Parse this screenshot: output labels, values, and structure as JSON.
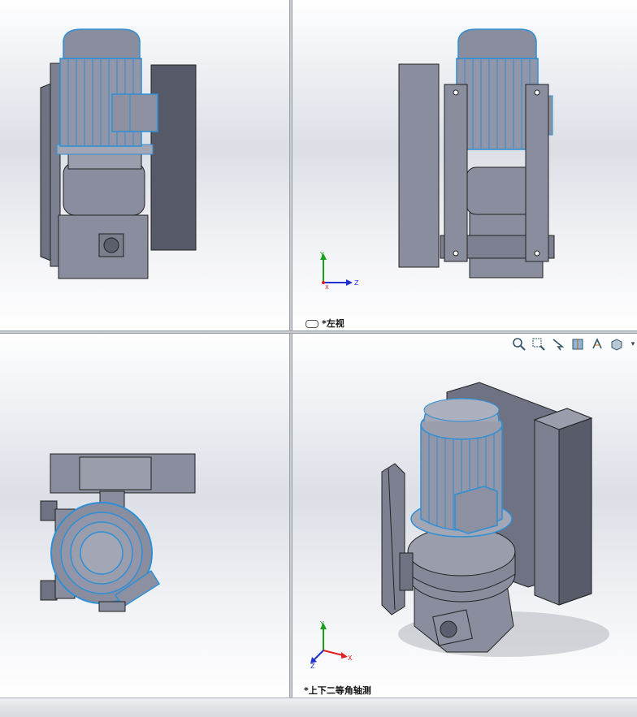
{
  "viewports": {
    "top_left": {
      "label": ""
    },
    "top_right": {
      "label": "*左视"
    },
    "bottom_left": {
      "label": ""
    },
    "bottom_right": {
      "label": "*上下二等角轴测"
    }
  },
  "triad": {
    "x": "X",
    "y": "Y",
    "z": "Z"
  },
  "colors": {
    "part_gray": "#8a8d9e",
    "part_dark": "#4e515e",
    "selected_blue": "#2d8fd6",
    "axis_x": "#e02020",
    "axis_y": "#18a018",
    "axis_z": "#2030d0"
  },
  "toolbar_icons": [
    "zoom-to-fit-icon",
    "zoom-to-area-icon",
    "previous-view-icon",
    "section-view-icon",
    "view-orientation-icon",
    "display-style-icon",
    "dropdown-arrow-icon"
  ]
}
